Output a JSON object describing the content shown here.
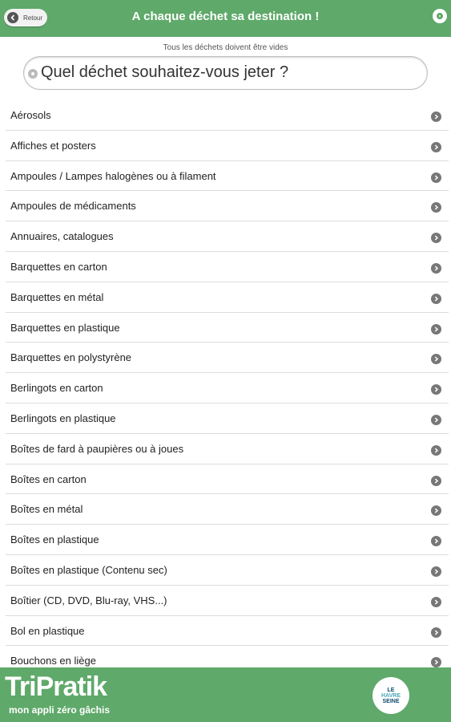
{
  "header": {
    "back_label": "Retour",
    "title": "A chaque déchet sa destination !",
    "settings_icon": "settings-icon"
  },
  "notice": "Tous les déchets doivent être vides",
  "search": {
    "placeholder": "Quel déchet souhaitez-vous jeter ?"
  },
  "items": [
    "Aérosols",
    "Affiches et posters",
    "Ampoules / Lampes halogènes ou à filament",
    "Ampoules de médicaments",
    "Annuaires, catalogues",
    "Barquettes en carton",
    "Barquettes en métal",
    "Barquettes en plastique",
    "Barquettes en polystyrène",
    "Berlingots en carton",
    "Berlingots en plastique",
    "Boîtes de fard à paupières ou à joues",
    "Boîtes en carton",
    "Boîtes en métal",
    "Boîtes en plastique",
    "Boîtes en plastique (Contenu sec)",
    "Boîtier (CD, DVD, Blu-ray, VHS...)",
    "Bol en plastique",
    "Bouchons en liège"
  ],
  "footer": {
    "brand": "TriPratik",
    "tagline": "mon appli zéro gâchis",
    "partner_logo_lines": [
      "LE",
      "HAVRE",
      "SEINE"
    ]
  },
  "colors": {
    "primary_green": "#5fa96a",
    "chevron": "#777777"
  }
}
